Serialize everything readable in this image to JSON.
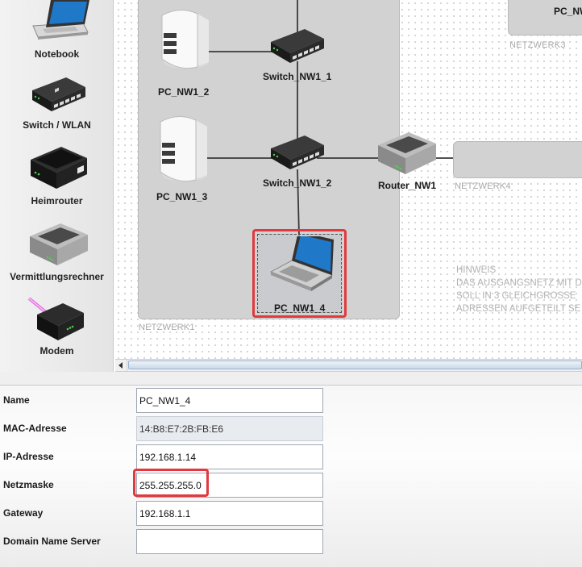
{
  "palette": {
    "items": [
      {
        "label": "Notebook",
        "icon": "laptop-icon"
      },
      {
        "label": "Switch / WLAN",
        "icon": "switch-icon"
      },
      {
        "label": "Heimrouter",
        "icon": "home-router-icon"
      },
      {
        "label": "Vermittlungsrechner",
        "icon": "router-icon"
      },
      {
        "label": "Modem",
        "icon": "modem-icon"
      }
    ]
  },
  "canvas": {
    "zones": {
      "nw1": "NETZWERK1",
      "nw3": "NETZWERK3",
      "nw4": "NETZWERK4"
    },
    "devices": {
      "pc_nw1_2": "PC_NW1_2",
      "pc_nw1_3": "PC_NW1_3",
      "switch_nw1_1": "Switch_NW1_1",
      "switch_nw1_2": "Switch_NW1_2",
      "router_nw1": "Router_NW1",
      "pc_nw1_4": "PC_NW1_4",
      "pc_nw3_partial": "PC_NW"
    },
    "note": {
      "line1": "HINWEIS",
      "line2": "DAS AUSGANGSNETZ MIT D",
      "line3": "SOLL IN 3 GLEICHGROSSE",
      "line4": "ADRESSEN AUFGETEILT SE"
    }
  },
  "properties": {
    "name_label": "Name",
    "name_value": "PC_NW1_4",
    "mac_label": "MAC-Adresse",
    "mac_value": "14:B8:E7:2B:FB:E6",
    "ip_label": "IP-Adresse",
    "ip_value": "192.168.1.14",
    "mask_label": "Netzmaske",
    "mask_value": "255.255.255.0",
    "gateway_label": "Gateway",
    "gateway_value": "192.168.1.1",
    "dns_label": "Domain Name Server",
    "dns_value": ""
  },
  "colors": {
    "highlight": "#e0393e",
    "zone": "#d2d2d2",
    "scroll_thumb": "#c9d9ea"
  }
}
